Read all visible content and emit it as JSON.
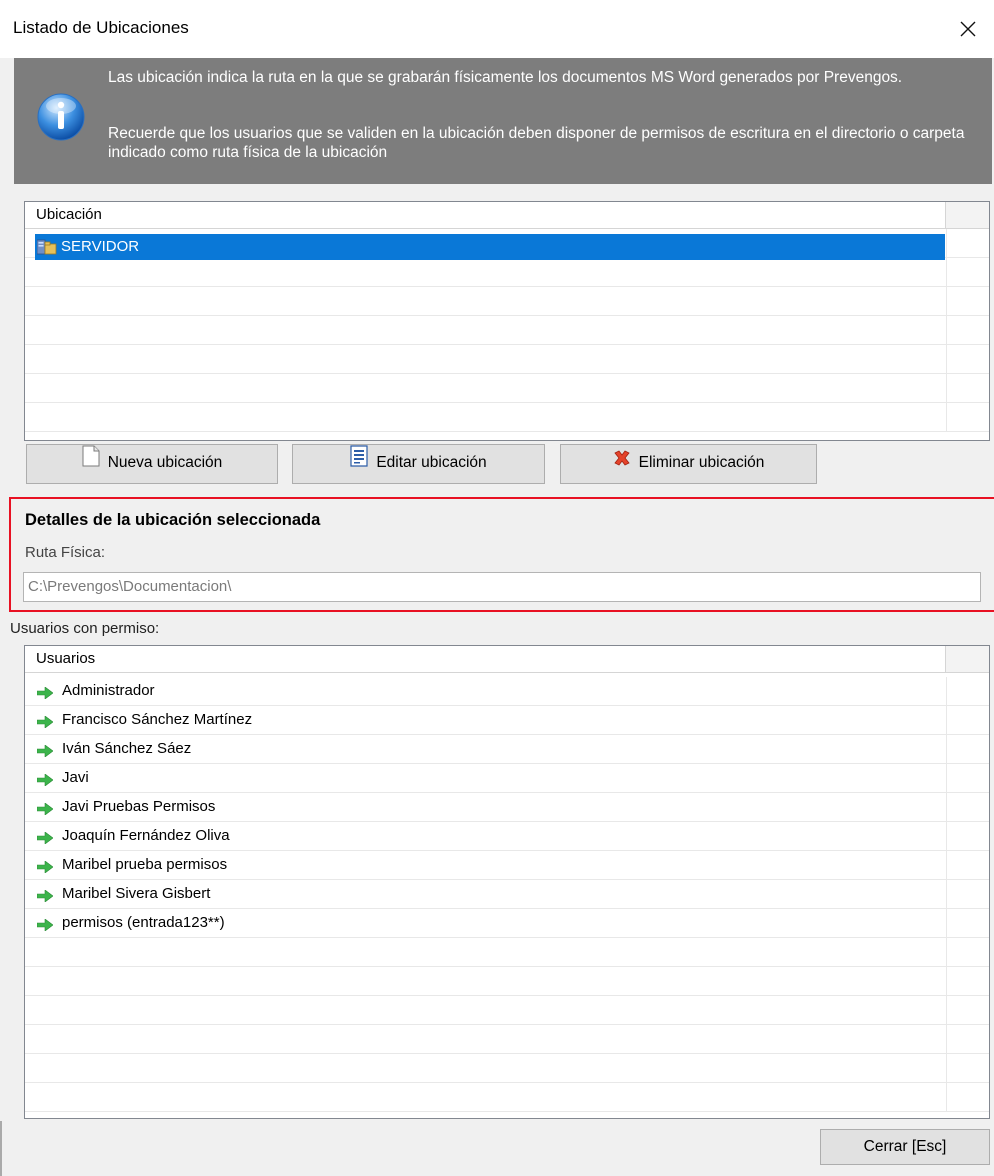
{
  "window": {
    "title": "Listado de Ubicaciones"
  },
  "info_banner": {
    "line1": "Las ubicación indica la ruta en la que se grabarán físicamente los documentos MS Word generados por Prevengos.",
    "line2": "Recuerde que los usuarios que se validen en la ubicación deben disponer de permisos de escritura en el directorio o carpeta indicado como ruta física de la ubicación"
  },
  "locations": {
    "header": "Ubicación",
    "items": [
      {
        "label": "SERVIDOR",
        "icon": "server-folder-icon",
        "selected": true
      }
    ]
  },
  "buttons": {
    "new_location": "Nueva ubicación",
    "edit_location": "Editar ubicación",
    "delete_location": "Eliminar ubicación",
    "close": "Cerrar  [Esc]"
  },
  "details": {
    "title": "Detalles de la ubicación seleccionada",
    "path_label": "Ruta Física:",
    "path_value": "C:\\Prevengos\\Documentacion\\"
  },
  "users": {
    "section_label": "Usuarios con permiso:",
    "header": "Usuarios",
    "items": [
      "Administrador",
      "Francisco Sánchez Martínez",
      "Iván Sánchez Sáez",
      "Javi",
      "Javi Pruebas Permisos",
      "Joaquín Fernández Oliva",
      "Maribel prueba permisos",
      "Maribel Sivera Gisbert",
      "permisos (entrada123**)"
    ]
  },
  "colors": {
    "selection": "#0a78d7",
    "banner_bg": "#7d7d7d",
    "highlight_border": "#e81123",
    "arrow_green": "#3cb44b"
  }
}
